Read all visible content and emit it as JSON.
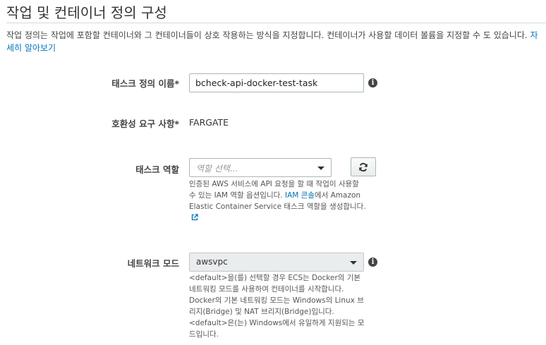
{
  "section": {
    "title": "작업 및 컨테이너 정의 구성",
    "intro_text": "작업 정의는 작업에 포함할 컨테이너와 그 컨테이너들이 상호 작용하는 방식을 지정합니다. 컨테이너가 사용할 데이터 볼륨을 지정할 수 도 있습니다. ",
    "learn_more_link": "자세히 알아보기"
  },
  "task_definition_name": {
    "label": "태스크 정의 이름*",
    "value": "bcheck-api-docker-test-task",
    "info_icon": "info-icon"
  },
  "compatibility": {
    "label": "호환성 요구 사항*",
    "value": "FARGATE"
  },
  "task_role": {
    "label": "태스크 역할",
    "placeholder": "역할 선택...",
    "refresh_icon": "refresh-icon",
    "help_text": "인증된 AWS 서비스에 API 요청을 할 때 작업이 사용할 수 있는 IAM 역할 옵션입니다. ",
    "help_link": "IAM 콘솔",
    "help_text_after": "에서 Amazon Elastic Container Service 태스크 역할을 생성합니다.",
    "external_link_icon": "external-link-icon"
  },
  "network_mode": {
    "label": "네트워크 모드",
    "selected": "awsvpc",
    "info_icon": "info-icon",
    "help_line_1": "<default>을(를) 선택할 경우 ECS는 Docker의 기본 네트워킹 모드를 사용하여 컨테이너를 시작합니다.",
    "help_line_2": "Docker의 기본 네트워킹 모드는 Windows의 Linux 브리지(Bridge) 및 NAT 브리지(Bridge)입니다.",
    "help_line_3": "<default>은(는) Windows에서 유일하게 지원되는 모드입니다."
  },
  "colors": {
    "link": "#0073bb",
    "border": "#aab7b8",
    "disabled_background": "#eaeded"
  }
}
